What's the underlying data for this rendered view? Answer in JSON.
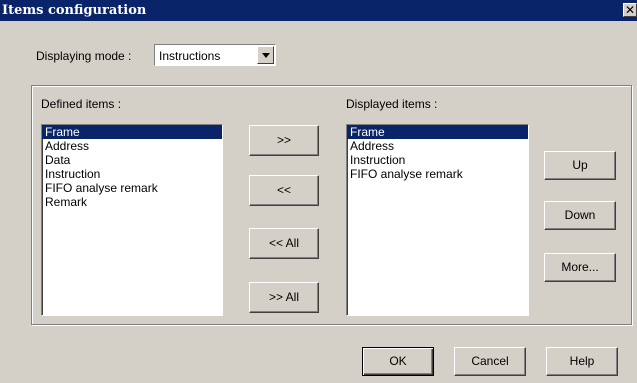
{
  "window": {
    "title": "Items configuration",
    "close_glyph": "✕"
  },
  "mode": {
    "label": "Displaying mode :",
    "selected": "Instructions"
  },
  "defined": {
    "label": "Defined items :",
    "items": [
      "Frame",
      "Address",
      "Data",
      "Instruction",
      "FIFO analyse remark",
      "Remark"
    ],
    "selected_index": 0
  },
  "displayed": {
    "label": "Displayed items :",
    "items": [
      "Frame",
      "Address",
      "Instruction",
      "FIFO analyse remark"
    ],
    "selected_index": 0
  },
  "transfer_buttons": {
    "add": ">>",
    "remove": "<<",
    "remove_all": "<< All",
    "add_all": ">> All"
  },
  "order_buttons": {
    "up": "Up",
    "down": "Down",
    "more": "More..."
  },
  "dialog_buttons": {
    "ok": "OK",
    "cancel": "Cancel",
    "help": "Help"
  },
  "colors": {
    "face": "#d4d0c8",
    "titlebar": "#0a246a",
    "selection": "#0a246a"
  }
}
